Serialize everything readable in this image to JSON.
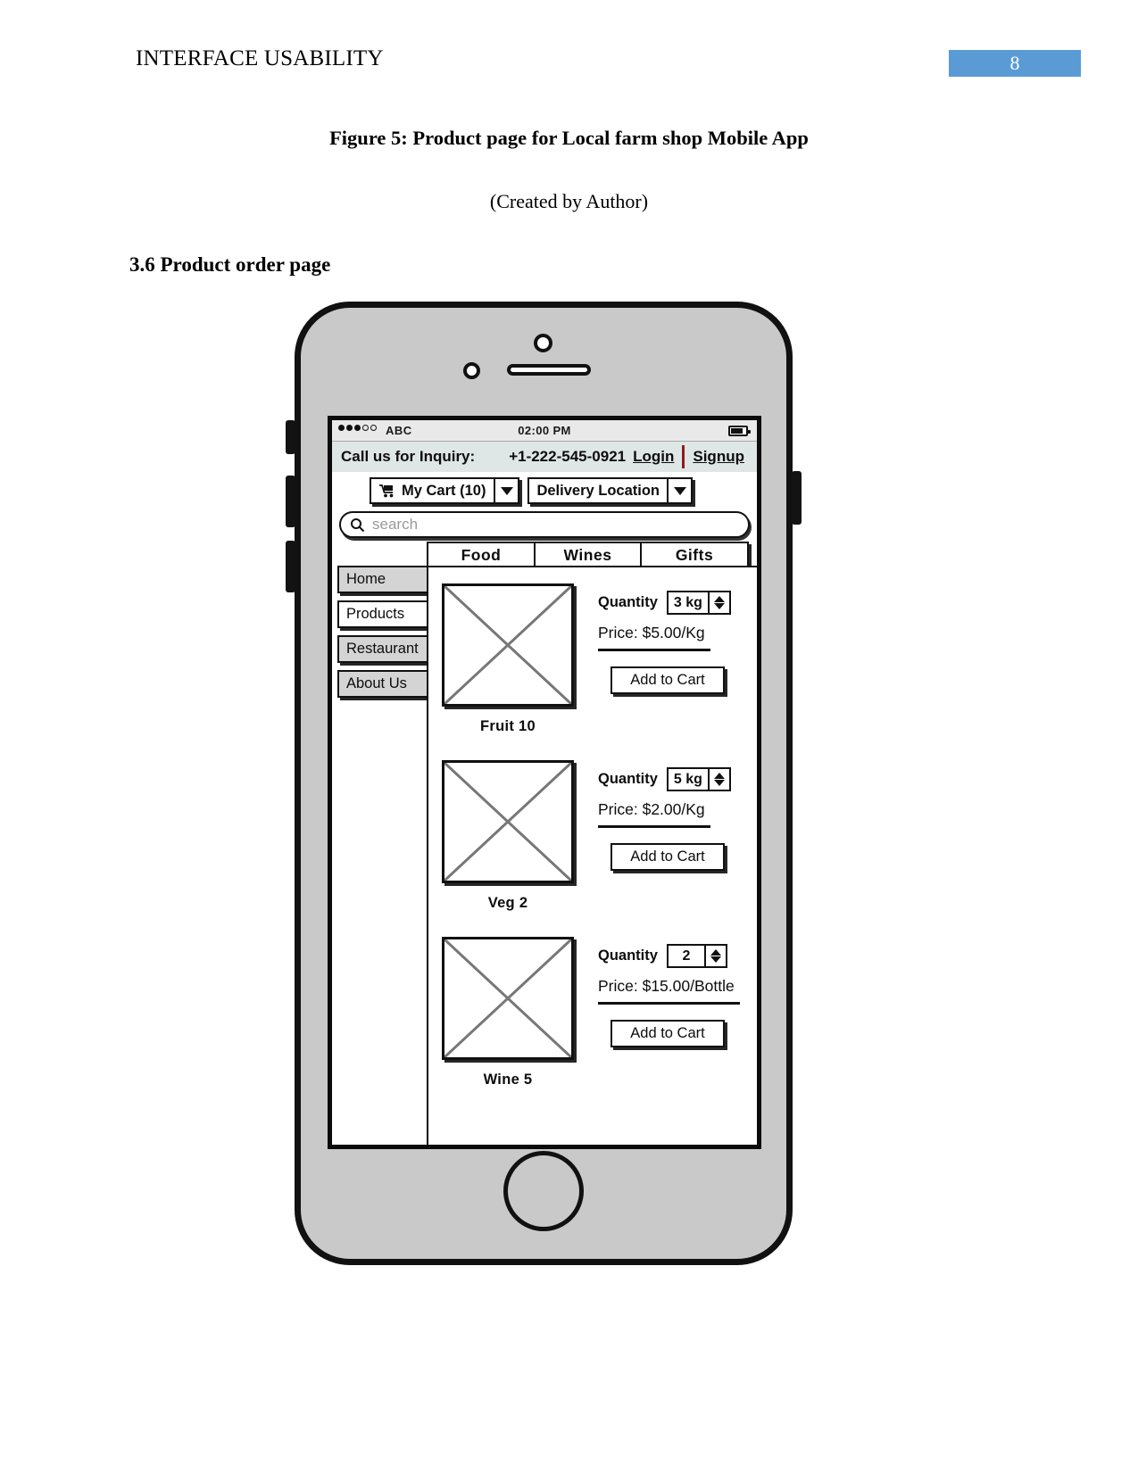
{
  "document": {
    "header_title": "INTERFACE USABILITY",
    "page_number": "8",
    "page_number_color": "#5B9BD5",
    "figure_caption": "Figure 5: Product page for Local farm shop Mobile App",
    "created_by": "(Created by Author)",
    "section_heading": "3.6 Product order page"
  },
  "phone": {
    "status_bar": {
      "carrier": "ABC",
      "time": "02:00 PM",
      "signal_dots_filled": 3,
      "signal_dots_empty": 2,
      "battery_icon": "battery-icon"
    },
    "inquiry": {
      "label": "Call us for Inquiry:",
      "phone": "+1-222-545-0921",
      "login": "Login",
      "signup": "Signup",
      "separator_color": "#8c1c1c"
    },
    "toolbar": {
      "cart_label": "My Cart (10)",
      "cart_icon": "shopping-cart-icon",
      "cart_caret_icon": "chevron-down-icon",
      "location_label": "Delivery Location",
      "location_caret_icon": "chevron-down-icon"
    },
    "search": {
      "placeholder": "search",
      "icon": "search-icon"
    },
    "tabs": [
      {
        "label": "Food"
      },
      {
        "label": "Wines"
      },
      {
        "label": "Gifts"
      }
    ],
    "sidebar": [
      {
        "label": "Home",
        "style": "gray"
      },
      {
        "label": "Products",
        "style": "white"
      },
      {
        "label": "Restaurant",
        "style": "gray"
      },
      {
        "label": "About Us",
        "style": "gray"
      }
    ],
    "products": [
      {
        "name": "Fruit 10",
        "quantity_label": "Quantity",
        "quantity_value": "3 kg",
        "price": "Price: $5.00/Kg",
        "add_to_cart": "Add to Cart",
        "image_placeholder": "image-placeholder-x"
      },
      {
        "name": "Veg 2",
        "quantity_label": "Quantity",
        "quantity_value": "5 kg",
        "price": "Price: $2.00/Kg",
        "add_to_cart": "Add to Cart",
        "image_placeholder": "image-placeholder-x"
      },
      {
        "name": "Wine 5",
        "quantity_label": "Quantity",
        "quantity_value": "2",
        "price": "Price: $15.00/Bottle",
        "add_to_cart": "Add to Cart",
        "image_placeholder": "image-placeholder-x"
      }
    ]
  }
}
